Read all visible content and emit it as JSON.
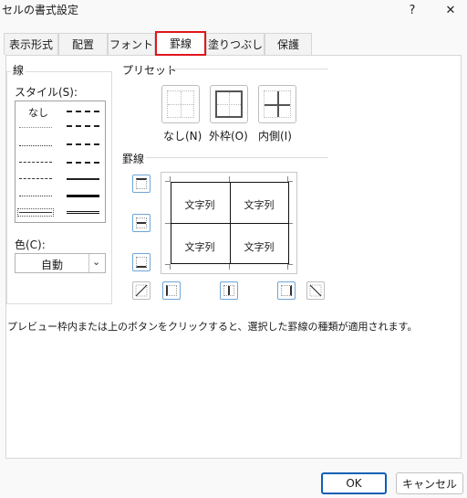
{
  "window": {
    "title": "セルの書式設定",
    "help": "?",
    "close": "✕"
  },
  "tabs": [
    {
      "label": "表示形式"
    },
    {
      "label": "配置"
    },
    {
      "label": "フォント"
    },
    {
      "label": "罫線"
    },
    {
      "label": "塗りつぶし"
    },
    {
      "label": "保護"
    }
  ],
  "active_tab": "罫線",
  "line": {
    "group_label": "線",
    "style_label": "スタイル(S):",
    "none_label": "なし",
    "color_label": "色(C):",
    "color_value": "自動"
  },
  "preset": {
    "group_label": "プリセット",
    "buttons": [
      {
        "label": "なし(N)"
      },
      {
        "label": "外枠(O)"
      },
      {
        "label": "内側(I)"
      }
    ]
  },
  "border": {
    "group_label": "罫線",
    "cells": [
      "文字列",
      "文字列",
      "文字列",
      "文字列"
    ]
  },
  "hint": "プレビュー枠内または上のボタンをクリックすると、選択した罫線の種類が適用されます。",
  "footer": {
    "ok": "OK",
    "cancel": "キャンセル"
  },
  "colors": {
    "accent": "#0f5fb5",
    "active_tab_outline": "#e0161b",
    "border_btn": "#6ea6d8"
  }
}
